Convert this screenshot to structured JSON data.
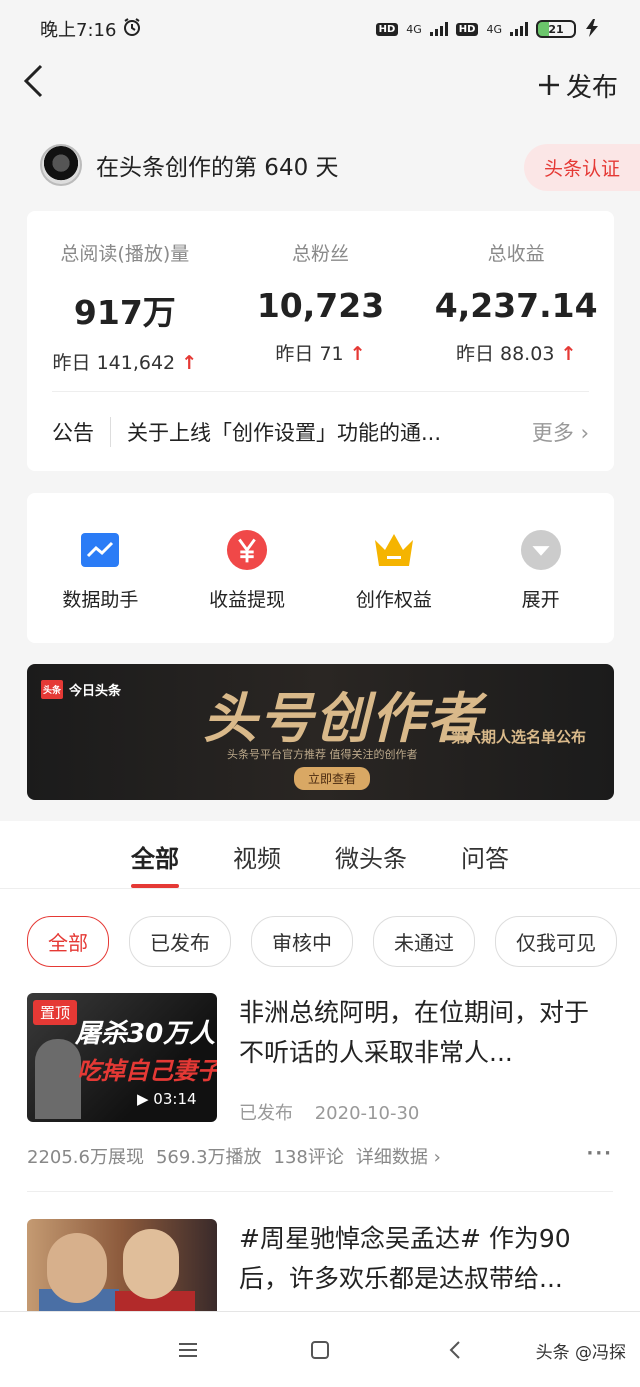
{
  "status_bar": {
    "time": "晚上7:16",
    "network1": "4G",
    "network2": "4G",
    "hd": "HD",
    "battery": "21"
  },
  "nav": {
    "back_icon": "chevron-left-icon",
    "publish_label": "发布"
  },
  "profile": {
    "text": "在头条创作的第 640 天",
    "cert_label": "头条认证"
  },
  "stats": [
    {
      "label": "总阅读(播放)量",
      "value": "917万",
      "yesterday": "昨日 141,642"
    },
    {
      "label": "总粉丝",
      "value": "10,723",
      "yesterday": "昨日 71"
    },
    {
      "label": "总收益",
      "value": "4,237.14",
      "yesterday": "昨日 88.03"
    }
  ],
  "notice": {
    "tag": "公告",
    "text": "关于上线「创作设置」功能的通...",
    "more": "更多"
  },
  "tools": [
    {
      "label": "数据助手",
      "icon": "chart-icon",
      "color": "#2b7cf6"
    },
    {
      "label": "收益提现",
      "icon": "yuan-icon",
      "color": "#f04848"
    },
    {
      "label": "创作权益",
      "icon": "crown-icon",
      "color": "#f5b400"
    },
    {
      "label": "展开",
      "icon": "expand-icon",
      "color": "#cccccc"
    }
  ],
  "banner": {
    "logo_box": "头条",
    "logo_text": "今日头条",
    "title": "头号创作者",
    "subtitle": "头条号平台官方推荐 值得关注的创作者",
    "right_text": "第六期人选名单公布",
    "button": "立即查看"
  },
  "tabs": [
    "全部",
    "视频",
    "微头条",
    "问答"
  ],
  "filters": [
    "全部",
    "已发布",
    "审核中",
    "未通过",
    "仅我可见"
  ],
  "posts": [
    {
      "pin": "置顶",
      "thumb_line1": "屠杀30万人",
      "thumb_line2": "吃掉自己妻子",
      "duration": "▶ 03:14",
      "title": "非洲总统阿明，在位期间，对于不听话的人采取非常人...",
      "status": "已发布",
      "date": "2020-10-30",
      "impressions": "2205.6万展现",
      "plays": "569.3万播放",
      "comments": "138评论",
      "detail": "详细数据"
    },
    {
      "title": "#周星驰悼念吴孟达# 作为90后，许多欢乐都是达叔带给..."
    }
  ],
  "bottom_nav": {
    "watermark": "头条 @冯探"
  },
  "colors": {
    "accent": "#e53935",
    "background": "#f5f5f5"
  }
}
